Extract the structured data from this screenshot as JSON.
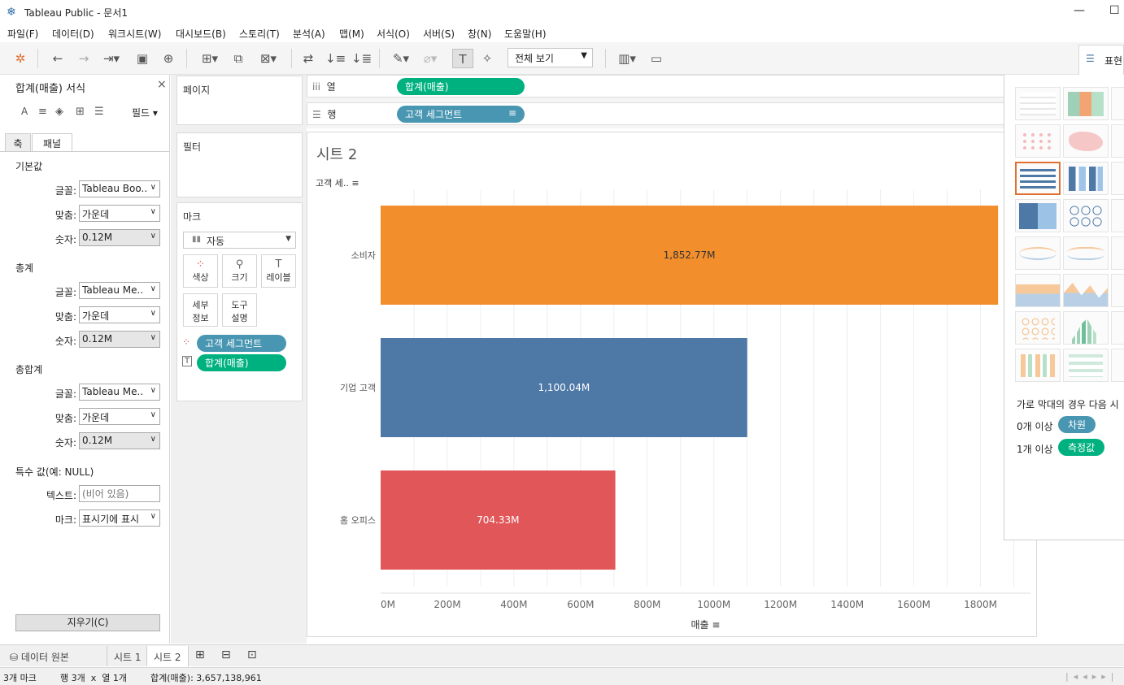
{
  "window": {
    "title": "Tableau Public - 문서1",
    "minimize": "—",
    "maximize": "☐"
  },
  "menu": [
    "파일(F)",
    "데이터(D)",
    "워크시트(W)",
    "대시보드(B)",
    "스토리(T)",
    "분석(A)",
    "맵(M)",
    "서식(O)",
    "서버(S)",
    "창(N)",
    "도움말(H)"
  ],
  "toolbar": {
    "fit": "전체 보기",
    "showme": "표현"
  },
  "format_pane": {
    "title": "합계(매출) 서식",
    "close": "×",
    "fields_label": "필드",
    "tabs": [
      "축",
      "패널"
    ],
    "sections": [
      {
        "title": "기본값",
        "rows": [
          {
            "label": "글꼴:",
            "value": "Tableau Boo.."
          },
          {
            "label": "맞춤:",
            "value": "가운데"
          },
          {
            "label": "숫자:",
            "value": "0.12M"
          }
        ]
      },
      {
        "title": "총계",
        "rows": [
          {
            "label": "글꼴:",
            "value": "Tableau Me.."
          },
          {
            "label": "맞춤:",
            "value": "가운데"
          },
          {
            "label": "숫자:",
            "value": "0.12M"
          }
        ]
      },
      {
        "title": "총합계",
        "rows": [
          {
            "label": "글꼴:",
            "value": "Tableau Me.."
          },
          {
            "label": "맞춤:",
            "value": "가운데"
          },
          {
            "label": "숫자:",
            "value": "0.12M"
          }
        ]
      }
    ],
    "special": {
      "title": "특수 값(예: NULL)",
      "text_label": "텍스트:",
      "text_placeholder": "(비어 있음)",
      "mark_label": "마크:",
      "mark_value": "표시기에 표시"
    },
    "clear": "지우기(C)"
  },
  "cards": {
    "pages": "페이지",
    "filters": "필터",
    "marks": {
      "title": "마크",
      "type": "자동",
      "buttons": [
        "색상",
        "크기",
        "레이블",
        "세부\n정보",
        "도구\n설명"
      ],
      "pills": [
        {
          "label": "고객 세그먼트"
        },
        {
          "label": "합계(매출)"
        }
      ]
    }
  },
  "shelves": {
    "columns": {
      "label": "열",
      "pill": "합계(매출)"
    },
    "rows": {
      "label": "행",
      "pill": "고객 세그먼트"
    }
  },
  "sheet": {
    "title": "시트 2",
    "row_header": "고객 세.."
  },
  "chart_data": {
    "type": "bar",
    "orientation": "horizontal",
    "categories": [
      "소비자",
      "기업 고객",
      "홈 오피스"
    ],
    "values": [
      1852.77,
      1100.04,
      704.33
    ],
    "data_labels": [
      "1,852.77M",
      "1,100.04M",
      "704.33M"
    ],
    "colors": [
      "#f28e2c",
      "#4e79a7",
      "#e15759"
    ],
    "xlabel": "매출",
    "xticks": [
      "0M",
      "200M",
      "400M",
      "600M",
      "800M",
      "1000M",
      "1200M",
      "1400M",
      "1600M",
      "1800M"
    ],
    "xlim": [
      0,
      1950
    ],
    "grid": true
  },
  "showme": {
    "hint": "가로 막대의 경우 다음 시",
    "line1_prefix": "0개 이상",
    "line1_pill": "차원",
    "line2_prefix": "1개 이상",
    "line2_pill": "측정값"
  },
  "sheet_tabs": {
    "source": "데이터 원본",
    "tabs": [
      "시트 1",
      "시트 2"
    ]
  },
  "status": {
    "marks": "3개 마크",
    "dims": "행 3개  x  열 1개",
    "sum": "합계(매출): 3,657,138,961"
  }
}
